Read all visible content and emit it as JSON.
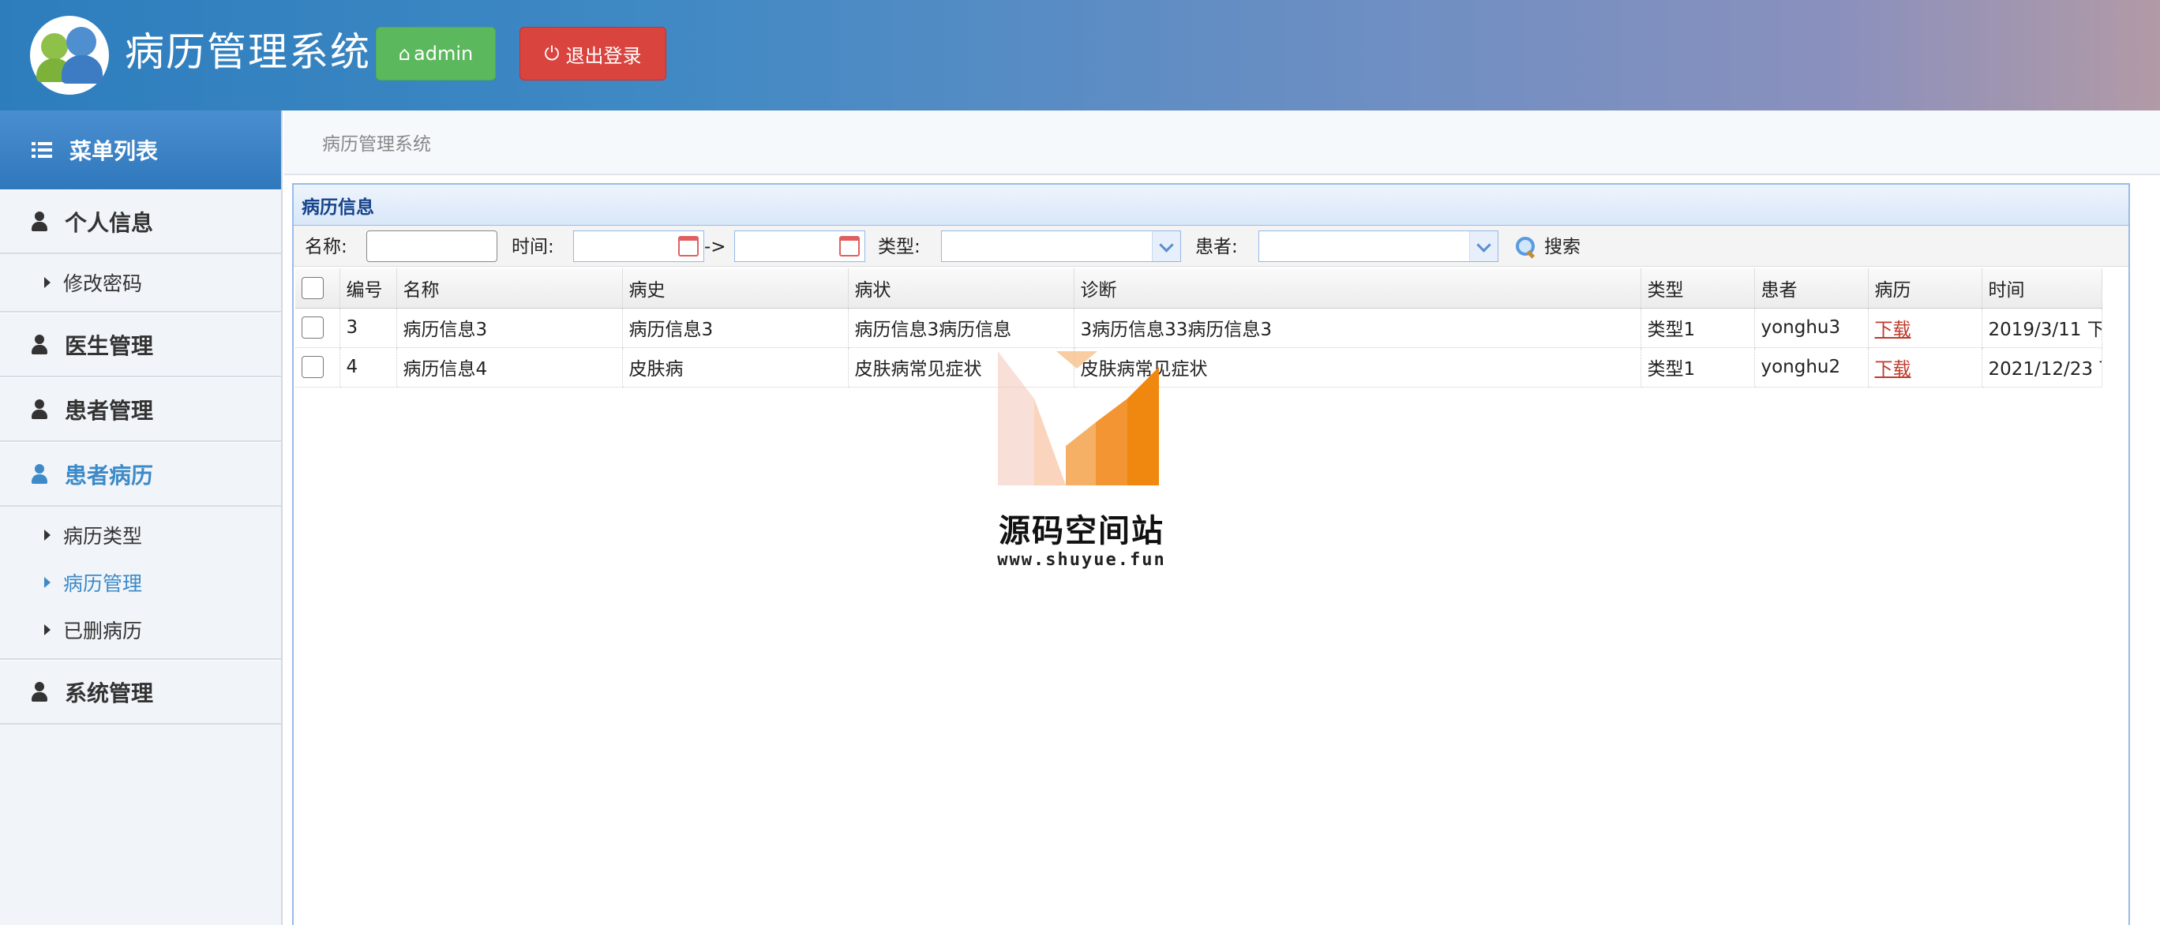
{
  "header": {
    "title": "病历管理系统",
    "admin_label": "admin",
    "logout_label": "退出登录"
  },
  "sidebar": {
    "menu_title": "菜单列表",
    "sections": [
      {
        "label": "个人信息",
        "active": false
      },
      {
        "label": "医生管理",
        "active": false
      },
      {
        "label": "患者管理",
        "active": false
      },
      {
        "label": "患者病历",
        "active": true
      },
      {
        "label": "系统管理",
        "active": false
      }
    ],
    "personal_subitems": [
      {
        "label": "修改密码"
      }
    ],
    "records_subitems": [
      {
        "label": "病历类型",
        "active": false
      },
      {
        "label": "病历管理",
        "active": true
      },
      {
        "label": "已删病历",
        "active": false
      }
    ]
  },
  "breadcrumb": "病历管理系统",
  "panel": {
    "title": "病历信息",
    "filters": {
      "name_label": "名称:",
      "time_label": "时间:",
      "range_sep": "->",
      "type_label": "类型:",
      "patient_label": "患者:",
      "search_label": "搜索",
      "name_value": "",
      "time_start": "",
      "time_end": "",
      "type_value": "",
      "patient_value": ""
    },
    "columns": [
      "编号",
      "名称",
      "病史",
      "病状",
      "诊断",
      "类型",
      "患者",
      "病历",
      "时间"
    ],
    "rows": [
      {
        "id": "3",
        "name": "病历信息3",
        "history": "病历信息3",
        "symptom": "病历信息3病历信息",
        "diagnosis": "3病历信息33病历信息3",
        "type": "类型1",
        "patient": "yonghu3",
        "record": "下载",
        "time": "2019/3/11 下"
      },
      {
        "id": "4",
        "name": "病历信息4",
        "history": "皮肤病",
        "symptom": "皮肤病常见症状",
        "diagnosis": "皮肤病常见症状",
        "type": "类型1",
        "patient": "yonghu2",
        "record": "下载",
        "time": "2021/12/23 下"
      }
    ]
  },
  "watermark": {
    "title": "源码空间站",
    "url": "www.shuyue.fun"
  },
  "colors": {
    "header_blue": "#2d7dbd",
    "admin_green": "#5cb85c",
    "logout_red": "#d9443f",
    "active_blue": "#3d8ac8",
    "panel_border": "#99bbe8",
    "link_red": "#c0392b",
    "watermark_orange": "#f39c3c"
  }
}
